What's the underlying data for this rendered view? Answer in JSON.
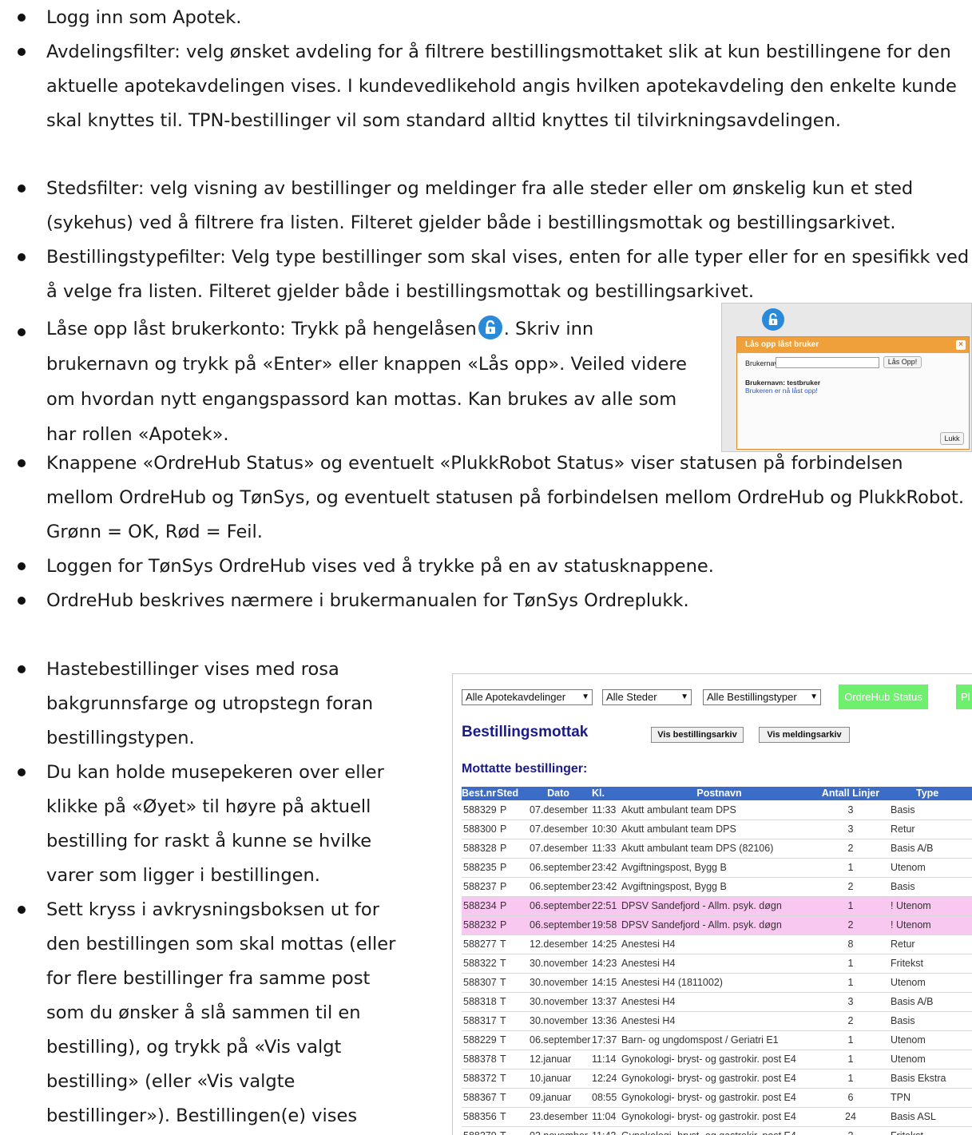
{
  "bullets": [
    "Logg inn som Apotek.",
    "Avdelingsfilter: velg ønsket avdeling for å filtrere bestillingsmottaket slik at kun bestillingene for den aktuelle apotekavdelingen vises. I kundevedlikehold angis hvilken apotekavdeling den enkelte kunde skal knyttes til. TPN-bestillinger vil som standard alltid knyttes til tilvirkningsavdelingen.",
    "Stedsfilter: velg visning av bestillinger og meldinger fra alle steder eller om ønskelig kun et sted (sykehus) ved å filtrere fra listen. Filteret gjelder både i bestillingsmottak og bestillingsarkivet.",
    "Bestillingstypefilter: Velg type bestillinger som skal vises, enten for alle typer eller for en spesifikk ved å velge fra listen. Filteret gjelder både i bestillingsmottak og bestillingsarkivet.",
    "Knappene «OrdreHub Status» og eventuelt «PlukkRobot Status» viser statusen på forbindelsen mellom OrdreHub og TønSys, og eventuelt statusen på forbindelsen mellom OrdreHub og PlukkRobot. Grønn = OK, Rød = Feil.",
    "Loggen for TønSys OrdreHub vises ved å trykke på en av statusknappene.",
    "OrdreHub beskrives nærmere i brukermanualen for TønSys Ordreplukk.",
    "Hastebestillinger vises med rosa bakgrunnsfarge og utropstegn foran bestillingstypen.",
    "Du kan holde musepekeren over eller klikke på «Øyet» til høyre på aktuell bestilling for raskt å kunne se hvilke varer som ligger i bestillingen.",
    "Sett kryss i avkrysningsboksen ut for den bestillingen som skal mottas (eller for flere bestillinger fra samme post som du ønsker å slå sammen til en bestilling), og trykk på «Vis valgt bestilling» (eller «Vis valgte bestillinger»). Bestillingen(e) vises detaljert:"
  ],
  "unlock_bullet": {
    "before": "Låse opp låst brukerkonto: Trykk på hengelåsen",
    "after": ". Skriv inn brukernavn og trykk på «Enter» eller knappen «Lås opp». Veiled videre om hvordan nytt engangspassord kan mottas. Kan brukes av alle som har rollen «Apotek»."
  },
  "unlock_dialog": {
    "title": "Lås opp låst bruker",
    "username_label": "Brukernavn:",
    "unlock_button": "Lås Opp!",
    "result_line1": "Brukernavn: testbruker",
    "result_line2": "Brukeren er nå låst opp!",
    "close_button": "Lukk"
  },
  "app": {
    "filters": {
      "department": "Alle Apotekavdelinger",
      "place": "Alle Steder",
      "order_type": "Alle Bestillingstyper"
    },
    "status_buttons": [
      "OrdreHub Status",
      "Pl"
    ],
    "status_color": "#6ef06e",
    "title": "Bestillingsmottak",
    "archive_button": "Vis bestillingsarkiv",
    "message_archive_button": "Vis meldingsarkiv",
    "subtitle": "Mottatte bestillinger:",
    "columns": [
      "Best.nr",
      "Sted",
      "Dato",
      "Kl.",
      "Postnavn",
      "Antall Linjer",
      "Type"
    ],
    "urgent_color": "#f9c8f0",
    "rows": [
      {
        "nr": "588329",
        "sted": "P",
        "dato": "07.desember",
        "kl": "11:33",
        "post": "Akutt ambulant team DPS",
        "linjer": "3",
        "type": "Basis",
        "urgent": false
      },
      {
        "nr": "588300",
        "sted": "P",
        "dato": "07.desember",
        "kl": "10:30",
        "post": "Akutt ambulant team DPS",
        "linjer": "3",
        "type": "Retur",
        "urgent": false
      },
      {
        "nr": "588328",
        "sted": "P",
        "dato": "07.desember",
        "kl": "11:33",
        "post": "Akutt ambulant team DPS (82106)",
        "linjer": "2",
        "type": "Basis A/B",
        "urgent": false
      },
      {
        "nr": "588235",
        "sted": "P",
        "dato": "06.september",
        "kl": "23:42",
        "post": "Avgiftningspost, Bygg B",
        "linjer": "1",
        "type": "Utenom",
        "urgent": false
      },
      {
        "nr": "588237",
        "sted": "P",
        "dato": "06.september",
        "kl": "23:42",
        "post": "Avgiftningspost, Bygg B",
        "linjer": "2",
        "type": "Basis",
        "urgent": false
      },
      {
        "nr": "588234",
        "sted": "P",
        "dato": "06.september",
        "kl": "22:51",
        "post": "DPSV Sandefjord - Allm. psyk. døgn",
        "linjer": "1",
        "type": "! Utenom",
        "urgent": true
      },
      {
        "nr": "588232",
        "sted": "P",
        "dato": "06.september",
        "kl": "19:58",
        "post": "DPSV Sandefjord - Allm. psyk. døgn",
        "linjer": "2",
        "type": "! Utenom",
        "urgent": true
      },
      {
        "nr": "588277",
        "sted": "T",
        "dato": "12.desember",
        "kl": "14:25",
        "post": "Anestesi H4",
        "linjer": "8",
        "type": "Retur",
        "urgent": false
      },
      {
        "nr": "588322",
        "sted": "T",
        "dato": "30.november",
        "kl": "14:23",
        "post": "Anestesi H4",
        "linjer": "1",
        "type": "Fritekst",
        "urgent": false
      },
      {
        "nr": "588307",
        "sted": "T",
        "dato": "30.november",
        "kl": "14:15",
        "post": "Anestesi H4 (1811002)",
        "linjer": "1",
        "type": "Utenom",
        "urgent": false
      },
      {
        "nr": "588318",
        "sted": "T",
        "dato": "30.november",
        "kl": "13:37",
        "post": "Anestesi H4",
        "linjer": "3",
        "type": "Basis A/B",
        "urgent": false
      },
      {
        "nr": "588317",
        "sted": "T",
        "dato": "30.november",
        "kl": "13:36",
        "post": "Anestesi H4",
        "linjer": "2",
        "type": "Basis",
        "urgent": false
      },
      {
        "nr": "588229",
        "sted": "T",
        "dato": "06.september",
        "kl": "17:37",
        "post": "Barn- og ungdomspost / Geriatri E1",
        "linjer": "1",
        "type": "Utenom",
        "urgent": false
      },
      {
        "nr": "588378",
        "sted": "T",
        "dato": "12.januar",
        "kl": "11:14",
        "post": "Gynokologi- bryst- og gastrokir. post E4",
        "linjer": "1",
        "type": "Utenom",
        "urgent": false
      },
      {
        "nr": "588372",
        "sted": "T",
        "dato": "10.januar",
        "kl": "12:24",
        "post": "Gynokologi- bryst- og gastrokir. post E4",
        "linjer": "1",
        "type": "Basis Ekstra",
        "urgent": false
      },
      {
        "nr": "588367",
        "sted": "T",
        "dato": "09.januar",
        "kl": "08:55",
        "post": "Gynokologi- bryst- og gastrokir. post E4",
        "linjer": "6",
        "type": "TPN",
        "urgent": false
      },
      {
        "nr": "588356",
        "sted": "T",
        "dato": "23.desember",
        "kl": "11:04",
        "post": "Gynokologi- bryst- og gastrokir. post E4",
        "linjer": "24",
        "type": "Basis ASL",
        "urgent": false
      },
      {
        "nr": "588279",
        "sted": "T",
        "dato": "03.november",
        "kl": "11:42",
        "post": "Gynokologi- bryst- og gastrokir. post E4",
        "linjer": "2",
        "type": "Fritekst",
        "urgent": false
      }
    ]
  }
}
